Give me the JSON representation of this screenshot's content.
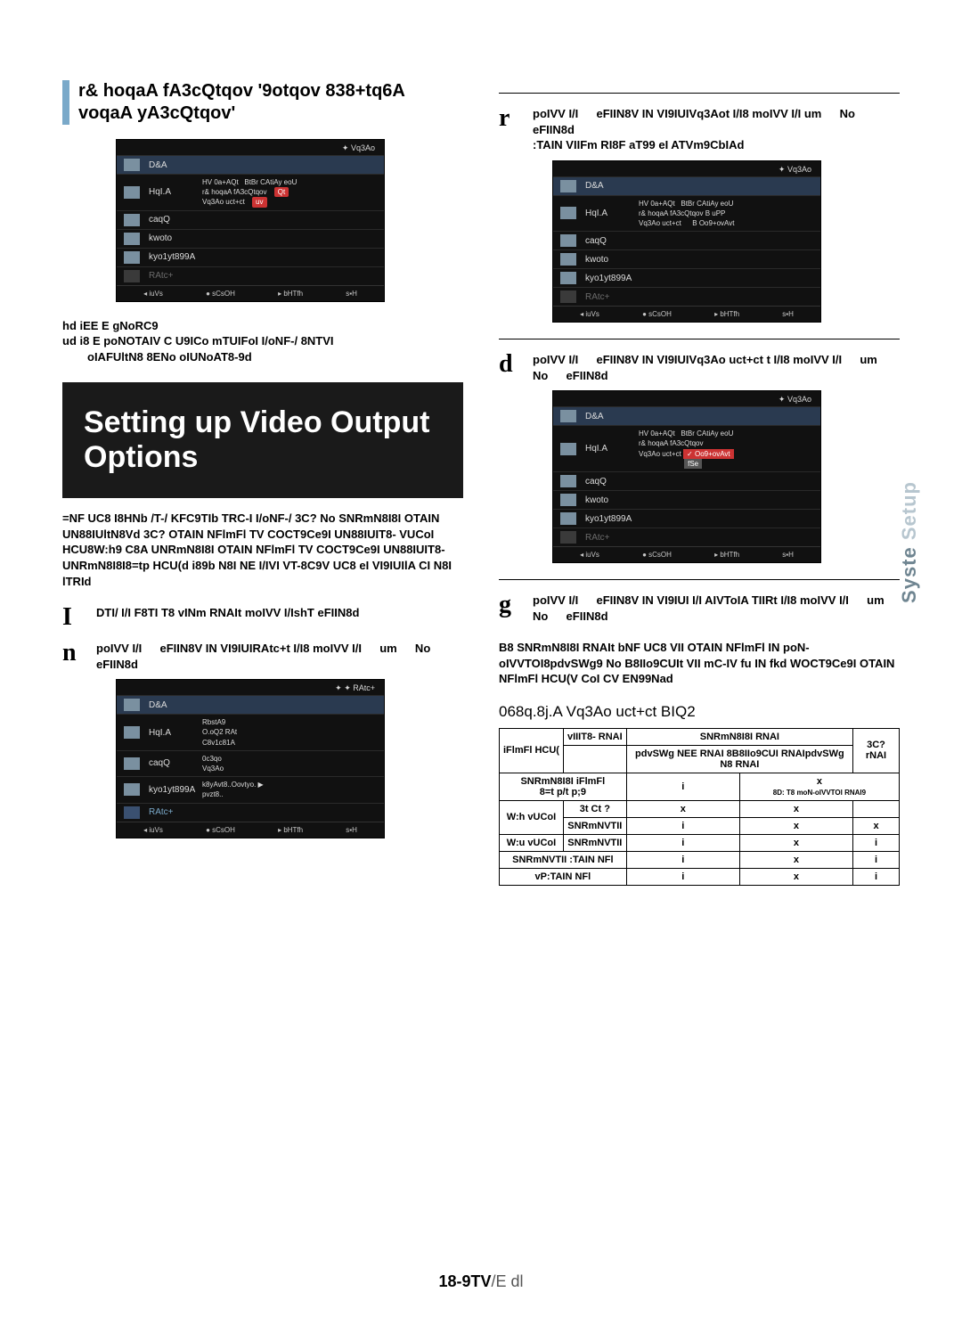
{
  "leftSection": {
    "title": "r& hoqaA fA3cQtqov '9otqov 838+tq6A voqaA yA3cQtqov'"
  },
  "menuCommon": {
    "topbar": "Vq3Ao",
    "items": [
      {
        "label": "D&A"
      },
      {
        "label": "HqI.A"
      },
      {
        "label": "caqQ"
      },
      {
        "label": "kwoto"
      },
      {
        "label": "kyo1yt899A"
      },
      {
        "label": "RAtc+"
      }
    ],
    "footer": [
      "◂ iuVs",
      "● sCsOH",
      "▸ bHTfh",
      "s▪H"
    ]
  },
  "menu1": {
    "lines": [
      "HV 0a+AQt",
      "BtBr CAtiAy eoU",
      "r& hoqaA fA3cQtqov",
      "Vq3Ao uct+ct"
    ],
    "pill1": "Qt",
    "pill2": "uv"
  },
  "leftNote1": "hd iEE E gNoRC9",
  "leftNote2": "ud i8 E poNOTAIV C U9ICo mTUIFoI I/oNF-/ 8NTVI",
  "leftNote2sub": "oIAFUltN8 8ENo oIUNoAT8-9d",
  "bigBox": "Setting up Video Output Options",
  "leftPara": "=NF UC8 I8HNb /T-/ KFC9TIb TRC-I I/oNF-/ 3C? No SNRmN8I8I OTAIN UN88IUltN8Vd 3C? OTAIN NFlmFl TV COCT9Ce9I UN88IUIT8- VUCoI HCU8W:h9 C8A UNRmN8I8I OTAIN NFlmFl TV COCT9Ce9I UN88IUIT8- UNRmN8I8I8=tp HCU(d i89b N8I NE I/IVI VT-8C9V UC8 eI VI9IUIlA CI N8I lTRId",
  "stepI": {
    "num": "I",
    "text": "DTI/ I/I F8TI T8 vINm RNAIt moIVV I/IshT eFIIN8d"
  },
  "stepN": {
    "num": "n",
    "text": "poIVV I/I   eFIIN8V IN VI9IUIRAtc+t I/I8 moIVV I/I   um   No   eFIIN8d"
  },
  "menu2": {
    "options": [
      "RbstA9",
      "O.oQ2 RAt",
      "C8v1c81A",
      "0c3qo",
      "Vq3Ao",
      "k8yAvt8..Oovtyo.",
      "pvzt8.."
    ]
  },
  "stepR": {
    "num": "r",
    "text": "poIVV I/I   eFIIN8V IN VI9IUIVq3Aot I/I8 moIVV I/I um   No   eFIIN8d",
    "sub": ":TAIN VIIFm RI8F aT99 eI ATVm9CbIAd"
  },
  "menu3": {
    "lines": [
      "HV 0a+AQt",
      "BtBr CAtiAy eoU",
      "r& hoqaA fA3cQtqov  B uPP",
      "Vq3Ao uct+ct   B Oo9+ovAvt"
    ]
  },
  "stepD": {
    "num": "d",
    "text": "poIVV I/I   eFIIN8V IN VI9IUIVq3Ao uct+ct t I/I8 moIVV I/I   um   No   eFIIN8d"
  },
  "menu4": {
    "lines": [
      "HV 0a+AQt",
      "BtBr CAtiAy eoU",
      "r& hoqaA fA3cQtqov",
      "Vq3Ao uct+ct"
    ],
    "hi1": "Oo9+ovAvt",
    "hi2": "fSe"
  },
  "stepG": {
    "num": "g",
    "text": "poIVV I/I   eFIIN8V IN VI9IUI I/I AIVToIA TIIRt I/I8 moIVV I/I   um   No   eFIIN8d"
  },
  "rightPara": "B8 SNRmN8I8I RNAIt bNF UC8 VII OTAIN NFlmFl IN poN-oIVVTOI8pdvSWg9 No B8IIo9CUIt VII mC-IV fu IN fkd WOCT9Ce9I OTAIN NFlmFl HCU(V CoI CV EN99Nad",
  "subhead": "068q.8j.A Vq3Ao uct+ct BIQ2",
  "table": {
    "head1": "vIIIT8- RNAI",
    "head2": "SNRmN8I8I RNAI",
    "head2a": "pdvSWg NEE RNAI 8B8IIo9CUI RNAIpdvSWg N8 RNAI",
    "head3": "3C? rNAI",
    "rows": [
      {
        "l1": "iFlmFl HCU(",
        "l2": "",
        "c1": "",
        "c2": ""
      },
      {
        "l1": "SNRmN8I8I iFlmFl",
        "l2": "8=t p/t p;9",
        "c1": "i",
        "c2": "x",
        "c2b": "8D: T8 moN-oIVVTOI RNAI9"
      },
      {
        "l1": "W:h vUCoI",
        "l2": "3t Ct ?",
        "c1": "x",
        "c2": "x"
      },
      {
        "l1": "",
        "l2": "SNRmNVTII",
        "c1": "i",
        "c2": "x",
        "c3": "x"
      },
      {
        "l1": "W:u vUCoI",
        "l2": "SNRmNVTII",
        "c1": "i",
        "c2": "x",
        "c3": "i"
      },
      {
        "l1": "SNRmNVTII :TAIN NFl",
        "l2": "",
        "c1": "i",
        "c2": "x",
        "c3": "i"
      },
      {
        "l1": "vP:TAIN NFl",
        "l2": "",
        "c1": "i",
        "c2": "x",
        "c3": "i"
      }
    ]
  },
  "sideTab": {
    "top": "Syste",
    "bottom": "Setup"
  },
  "pageFooter": {
    "bold": "18-9TV",
    "light": "/E dl"
  }
}
